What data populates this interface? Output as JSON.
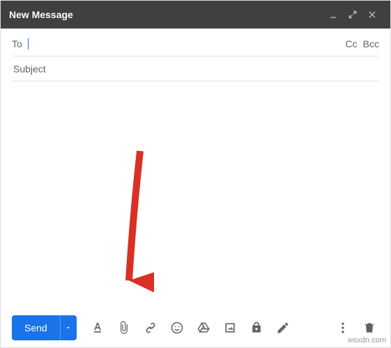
{
  "window": {
    "title": "New Message"
  },
  "fields": {
    "to_label": "To",
    "to_value": "",
    "cc_label": "Cc",
    "bcc_label": "Bcc",
    "subject_placeholder": "Subject",
    "subject_value": ""
  },
  "toolbar": {
    "send_label": "Send"
  },
  "icons": {
    "minimize": "minimize-icon",
    "expand": "expand-icon",
    "close": "close-icon",
    "format": "format-text-icon",
    "attach": "attach-file-icon",
    "link": "insert-link-icon",
    "emoji": "insert-emoji-icon",
    "drive": "insert-drive-icon",
    "photo": "insert-photo-icon",
    "confidential": "confidential-mode-icon",
    "pen": "insert-signature-icon",
    "more": "more-options-icon",
    "trash": "discard-draft-icon",
    "send_more": "send-options-icon"
  },
  "colors": {
    "accent": "#1a73e8",
    "header_bg": "#404040",
    "icon": "#5f6368",
    "annotation": "#d93025"
  },
  "watermark": "wsxdn.com"
}
